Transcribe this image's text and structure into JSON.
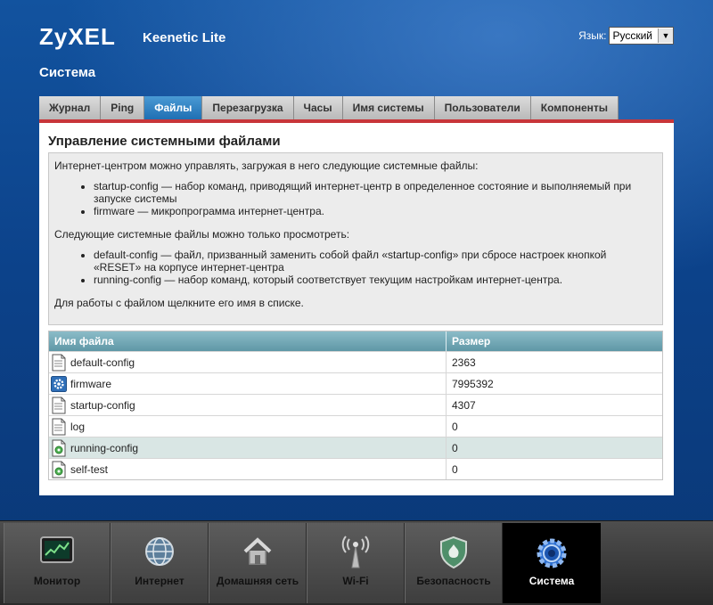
{
  "header": {
    "brand": "ZyXEL",
    "model": "Keenetic Lite",
    "language_label": "Язык:",
    "language_value": "Русский",
    "section": "Система"
  },
  "tabs": [
    {
      "label": "Журнал",
      "active": false
    },
    {
      "label": "Ping",
      "active": false
    },
    {
      "label": "Файлы",
      "active": true
    },
    {
      "label": "Перезагрузка",
      "active": false
    },
    {
      "label": "Часы",
      "active": false
    },
    {
      "label": "Имя системы",
      "active": false
    },
    {
      "label": "Пользователи",
      "active": false
    },
    {
      "label": "Компоненты",
      "active": false
    }
  ],
  "panel": {
    "title": "Управление системными файлами",
    "intro1": "Интернет-центром можно управлять, загружая в него следующие системные файлы:",
    "list1": [
      "startup-config — набор команд, приводящий интернет-центр в определенное состояние и выполняемый при запуске системы",
      "firmware — микропрограмма интернет-центра."
    ],
    "intro2": "Следующие системные файлы можно только просмотреть:",
    "list2": [
      "default-config — файл, призванный заменить собой файл «startup-config» при сбросе настроек кнопкой «RESET» на корпусе интернет-центра",
      "running-config — набор команд, который соответствует текущим настройкам интернет-центра."
    ],
    "footer": "Для работы с файлом щелкните его имя в списке."
  },
  "table": {
    "col_name": "Имя файла",
    "col_size": "Размер",
    "rows": [
      {
        "name": "default-config",
        "size": "2363",
        "icon": "document-icon"
      },
      {
        "name": "firmware",
        "size": "7995392",
        "icon": "gear-icon"
      },
      {
        "name": "startup-config",
        "size": "4307",
        "icon": "document-icon"
      },
      {
        "name": "log",
        "size": "0",
        "icon": "document-icon"
      },
      {
        "name": "running-config",
        "size": "0",
        "icon": "document-gear-icon"
      },
      {
        "name": "self-test",
        "size": "0",
        "icon": "document-gear-icon"
      }
    ]
  },
  "dock": [
    {
      "label": "Монитор",
      "icon": "monitor-icon",
      "active": false
    },
    {
      "label": "Интернет",
      "icon": "globe-icon",
      "active": false
    },
    {
      "label": "Домашняя сеть",
      "icon": "house-icon",
      "active": false
    },
    {
      "label": "Wi-Fi",
      "icon": "antenna-icon",
      "active": false
    },
    {
      "label": "Безопасность",
      "icon": "shield-icon",
      "active": false
    },
    {
      "label": "Система",
      "icon": "gear-icon",
      "active": true
    }
  ],
  "colors": {
    "accent_blue": "#1f6fb3",
    "tab_underline": "#c8363a",
    "table_header": "#6fa4b2",
    "row_highlight": "#d9e6e4"
  }
}
